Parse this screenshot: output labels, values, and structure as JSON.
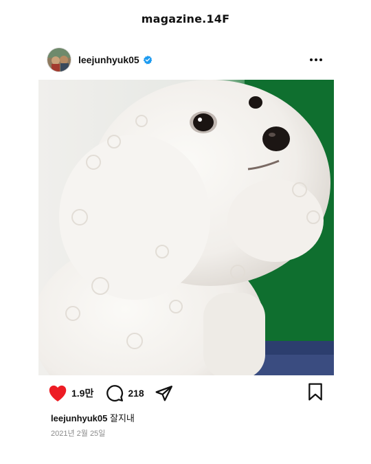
{
  "brand": {
    "title": "magazine.14F"
  },
  "post": {
    "username": "leejunhyuk05",
    "verified": true,
    "likes": "1.9만",
    "comments": "218",
    "caption_user": "leejunhyuk05",
    "caption_text": "잘지내",
    "date": "2021년 2월 25일"
  },
  "icons": {
    "avatar": "avatar",
    "verified": "verified-badge-icon",
    "more": "more-options-icon",
    "like": "heart-icon",
    "comment": "comment-icon",
    "share": "share-icon",
    "save": "bookmark-icon"
  },
  "colors": {
    "heart": "#ed1c24",
    "verified": "#1d9bf0",
    "text": "#111111",
    "muted": "#8a8a8a"
  }
}
